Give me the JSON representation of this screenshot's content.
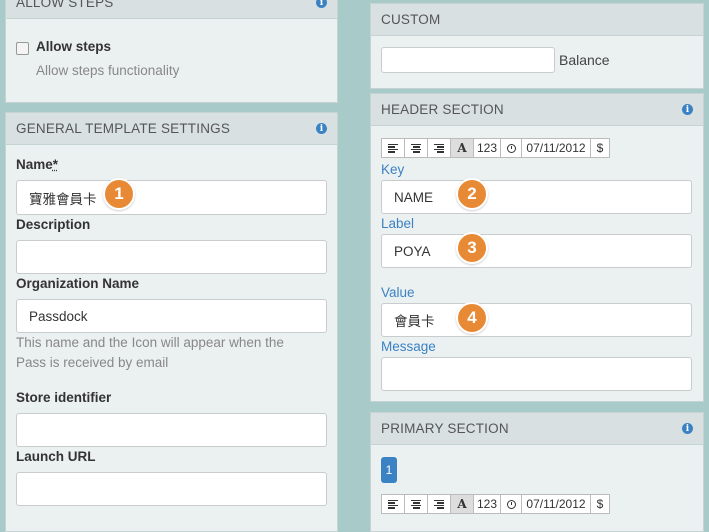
{
  "allow_steps": {
    "title": "ALLOW STEPS",
    "checkbox_label": "Allow steps",
    "help": "Allow steps functionality"
  },
  "general": {
    "title": "GENERAL TEMPLATE SETTINGS",
    "name_label": "Name",
    "name_required": "*",
    "name_value": "寶雅會員卡",
    "description_label": "Description",
    "description_value": "",
    "org_label": "Organization Name",
    "org_value": "Passdock",
    "org_help": "This name and the Icon will appear when the Pass is received by email",
    "store_label": "Store identifier",
    "store_value": "",
    "launch_label": "Launch URL",
    "launch_value": ""
  },
  "custom": {
    "title": "CUSTOM",
    "input_value": "",
    "balance_label": "Balance"
  },
  "header_section": {
    "title": "HEADER SECTION",
    "key_label": "Key",
    "key_value": "NAME",
    "label_label": "Label",
    "label_value": "POYA",
    "value_label": "Value",
    "value_value": "會員卡",
    "message_label": "Message",
    "message_value": ""
  },
  "primary_section": {
    "title": "PRIMARY SECTION",
    "tab_number": "1"
  },
  "toolbar": {
    "font_label": "A",
    "number_label": "123",
    "date_label": "07/11/2012",
    "currency_label": "$"
  },
  "badges": [
    "1",
    "2",
    "3",
    "4"
  ],
  "icons": {
    "info": "i"
  },
  "colors": {
    "accent_blue": "#3b82c4",
    "badge_orange": "#e88a35",
    "background_teal": "#a8cbc9"
  }
}
